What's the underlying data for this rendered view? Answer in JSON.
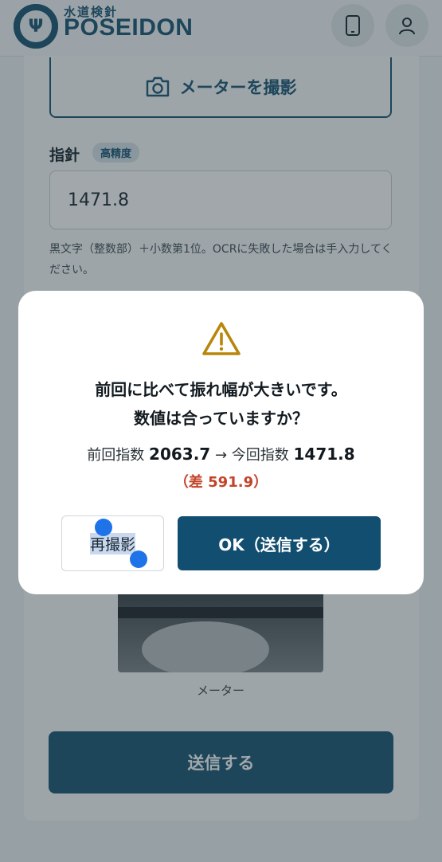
{
  "header": {
    "logo_text": "POSEIDON",
    "logo_subtitle": "水道検針",
    "logo_emblem_text": "POSEIDON",
    "device_icon": "smartphone-icon",
    "user_icon": "user-icon"
  },
  "form": {
    "camera_button_label": "メーターを撮影",
    "reading_label": "指針",
    "precision_badge": "高精度",
    "reading_value": "1471.8",
    "help_text": "黒文字（整数部）＋小数第1位。OCRに失敗した場合は手入力してください。",
    "photo_caption": "メーター",
    "submit_label": "送信する"
  },
  "modal": {
    "icon": "warning-icon",
    "title_line1": "前回に比べて振れ幅が大きいです。",
    "title_line2": "数値は合っていますか？",
    "previous_label": "前回指数",
    "previous_value": "2063.7",
    "arrow": "→",
    "current_label": "今回指数",
    "current_value": "1471.8",
    "difference_text": "（差 591.9）",
    "retake_label": "再撮影",
    "ok_label": "OK（送信する）"
  },
  "colors": {
    "brand": "#1d5877",
    "warning": "#b8860b",
    "difference": "#c2442a",
    "selection_handle": "#1f73e8"
  }
}
